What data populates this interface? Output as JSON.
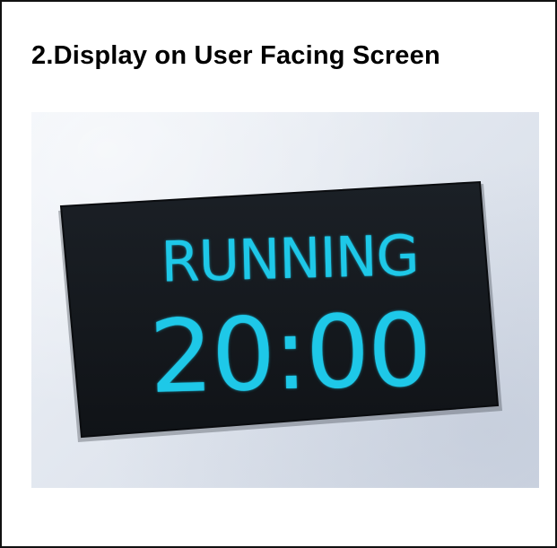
{
  "slide": {
    "title": "2.Display on User Facing Screen"
  },
  "display": {
    "status": "RUNNING",
    "timer": "20:00",
    "text_color": "#1ec8e8",
    "screen_color": "#14181d",
    "casing_color": "#e3e8f0"
  }
}
